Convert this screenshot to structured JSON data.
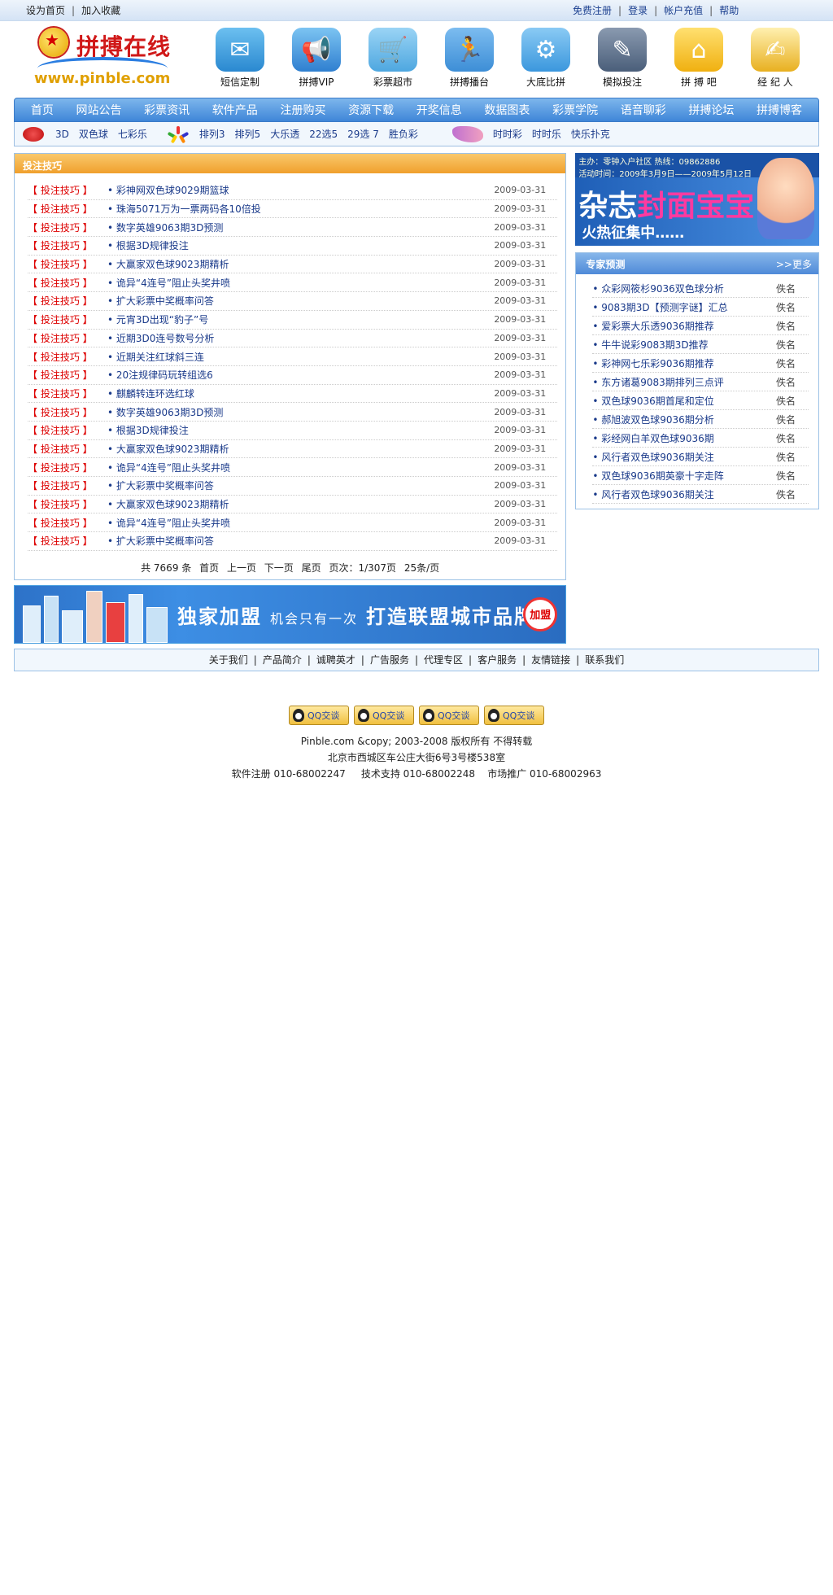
{
  "topbar": {
    "left": [
      "设为首页",
      "加入收藏"
    ],
    "right": [
      "免费注册",
      "登录",
      "帐户充值",
      "帮助"
    ]
  },
  "logo": {
    "title": "拼搏在线",
    "url": "www.pinble.com"
  },
  "icons": [
    {
      "label": "短信定制",
      "icon": "sms-icon",
      "color": "#3a9ad9"
    },
    {
      "label": "拼搏VIP",
      "icon": "vip-speaker-icon",
      "color": "#2f7fd0"
    },
    {
      "label": "彩票超市",
      "icon": "cart-icon",
      "color": "#4ea7e0"
    },
    {
      "label": "拼搏播台",
      "icon": "podium-icon",
      "color": "#3d8ed6"
    },
    {
      "label": "大底比拼",
      "icon": "gear-icon",
      "color": "#3b97dd"
    },
    {
      "label": "模拟投注",
      "icon": "pencil-icon",
      "color": "#5a6e8a"
    },
    {
      "label": "拼 搏 吧",
      "icon": "house-icon",
      "color": "#f0c020"
    },
    {
      "label": "经 纪 人",
      "icon": "document-icon",
      "color": "#e8b020"
    }
  ],
  "nav": [
    "首页",
    "网站公告",
    "彩票资讯",
    "软件产品",
    "注册购买",
    "资源下载",
    "开奖信息",
    "数据图表",
    "彩票学院",
    "语音聊彩",
    "拼搏论坛",
    "拼搏博客"
  ],
  "subnav": {
    "group1": [
      "3D",
      "双色球",
      "七彩乐"
    ],
    "group2": [
      "排列3",
      "排列5",
      "大乐透",
      "22选5",
      "29选 7",
      "胜负彩"
    ],
    "group3": [
      "时时彩",
      "时时乐",
      "快乐扑克"
    ]
  },
  "articles": {
    "heading": "投注技巧",
    "rows": [
      {
        "cat": "【 投注技巧 】",
        "title": "彩神网双色球9029期篮球",
        "date": "2009-03-31"
      },
      {
        "cat": "【 投注技巧 】",
        "title": "珠海5071万为一票两码各10倍投",
        "date": "2009-03-31"
      },
      {
        "cat": "【 投注技巧 】",
        "title": "数字英雄9063期3D预测",
        "date": "2009-03-31"
      },
      {
        "cat": "【 投注技巧 】",
        "title": "根据3D规律投注",
        "date": "2009-03-31"
      },
      {
        "cat": "【 投注技巧 】",
        "title": "大赢家双色球9023期精析",
        "date": "2009-03-31"
      },
      {
        "cat": "【 投注技巧 】",
        "title": "诡异“4连号”阻止头奖井喷",
        "date": "2009-03-31"
      },
      {
        "cat": "【 投注技巧 】",
        "title": "扩大彩票中奖概率问答",
        "date": "2009-03-31"
      },
      {
        "cat": "【 投注技巧 】",
        "title": "元宵3D出现“豹子”号",
        "date": "2009-03-31"
      },
      {
        "cat": "【 投注技巧 】",
        "title": "近期3D0连号数号分析",
        "date": "2009-03-31"
      },
      {
        "cat": "【 投注技巧 】",
        "title": "近期关注红球斜三连",
        "date": "2009-03-31"
      },
      {
        "cat": "【 投注技巧 】",
        "title": "20注规律码玩转组选6",
        "date": "2009-03-31"
      },
      {
        "cat": "【 投注技巧 】",
        "title": "麒麟转连环选红球",
        "date": "2009-03-31"
      },
      {
        "cat": "【 投注技巧 】",
        "title": "数字英雄9063期3D预测",
        "date": "2009-03-31"
      },
      {
        "cat": "【 投注技巧 】",
        "title": "根据3D规律投注",
        "date": "2009-03-31"
      },
      {
        "cat": "【 投注技巧 】",
        "title": "大赢家双色球9023期精析",
        "date": "2009-03-31"
      },
      {
        "cat": "【 投注技巧 】",
        "title": "诡异“4连号”阻止头奖井喷",
        "date": "2009-03-31"
      },
      {
        "cat": "【 投注技巧 】",
        "title": "扩大彩票中奖概率问答",
        "date": "2009-03-31"
      },
      {
        "cat": "【 投注技巧 】",
        "title": "大赢家双色球9023期精析",
        "date": "2009-03-31"
      },
      {
        "cat": "【 投注技巧 】",
        "title": "诡异“4连号”阻止头奖井喷",
        "date": "2009-03-31"
      },
      {
        "cat": "【 投注技巧 】",
        "title": "扩大彩票中奖概率问答",
        "date": "2009-03-31"
      }
    ],
    "pager": {
      "total": "共 7669 条",
      "first": "首页",
      "prev": "上一页",
      "next": "下一页",
      "last": "尾页",
      "page": "页次：1/307页",
      "per": "25条/页"
    }
  },
  "banner": {
    "main": "独家加盟",
    "mid": "机会只有一次",
    "tail": "打造联盟城市品牌",
    "join": "加盟"
  },
  "right_banner": {
    "top1": "主办：零钟入户社区  热线：09862886",
    "top2": "活动时间：2009年3月9日——2009年5月12日",
    "big_a": "杂志",
    "big_b": "封面宝宝",
    "sub": "火热征集中……"
  },
  "expert": {
    "heading": "专家预测",
    "more": ">>更多",
    "rows": [
      {
        "title": "众彩网筱杉9036双色球分析",
        "author": "佚名"
      },
      {
        "title": "9083期3D【预测字谜】汇总",
        "author": "佚名"
      },
      {
        "title": "爱彩票大乐透9036期推荐",
        "author": "佚名"
      },
      {
        "title": "牛牛说彩9083期3D推荐",
        "author": "佚名"
      },
      {
        "title": "彩神网七乐彩9036期推荐",
        "author": "佚名"
      },
      {
        "title": "东方诸葛9083期排列三点评",
        "author": "佚名"
      },
      {
        "title": "双色球9036期首尾和定位",
        "author": "佚名"
      },
      {
        "title": "郝旭波双色球9036期分析",
        "author": "佚名"
      },
      {
        "title": "彩经网白羊双色球9036期",
        "author": "佚名"
      },
      {
        "title": "风行者双色球9036期关注",
        "author": "佚名"
      },
      {
        "title": "双色球9036期英豪十字走阵",
        "author": "佚名"
      },
      {
        "title": "风行者双色球9036期关注",
        "author": "佚名"
      }
    ]
  },
  "footer": {
    "links": [
      "关于我们",
      "产品简介",
      "诚聘英才",
      "广告服务",
      "代理专区",
      "客户服务",
      "友情链接",
      "联系我们"
    ],
    "qq": [
      "QQ交谈",
      "QQ交谈",
      "QQ交谈",
      "QQ交谈"
    ],
    "copyright": "Pinble.com &copy; 2003-2008  版权所有 不得转载",
    "address": "北京市西城区车公庄大街6号3号楼538室",
    "contact": "软件注册 010-68002247     技术支持 010-68002248    市场推广 010-68002963"
  }
}
